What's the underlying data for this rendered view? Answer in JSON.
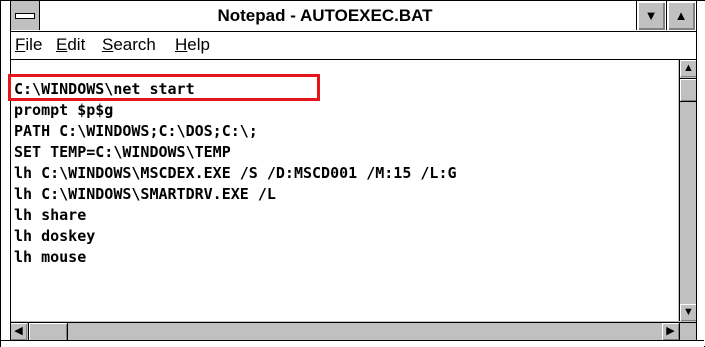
{
  "window": {
    "title": "Notepad - AUTOEXEC.BAT"
  },
  "menubar": {
    "items": [
      {
        "key": "F",
        "rest": "ile"
      },
      {
        "key": "E",
        "rest": "dit"
      },
      {
        "key": "S",
        "rest": "earch"
      },
      {
        "key": "H",
        "rest": "elp"
      }
    ]
  },
  "titlebar": {
    "min_icon": "▼",
    "max_icon": "▲",
    "sysmenu_icon": "system-menu-icon"
  },
  "editor": {
    "lines": [
      "C:\\WINDOWS\\net start",
      "prompt $p$g",
      "PATH C:\\WINDOWS;C:\\DOS;C:\\;",
      "SET TEMP=C:\\WINDOWS\\TEMP",
      "lh C:\\WINDOWS\\MSCDEX.EXE /S /D:MSCD001 /M:15 /L:G",
      "lh C:\\WINDOWS\\SMARTDRV.EXE /L",
      "lh share",
      "lh doskey",
      "lh mouse"
    ]
  },
  "scroll": {
    "up": "▲",
    "down": "▼",
    "left": "◀",
    "right": "▶"
  },
  "colors": {
    "highlight": "#e8141b",
    "chrome": "#c0c0c0"
  }
}
